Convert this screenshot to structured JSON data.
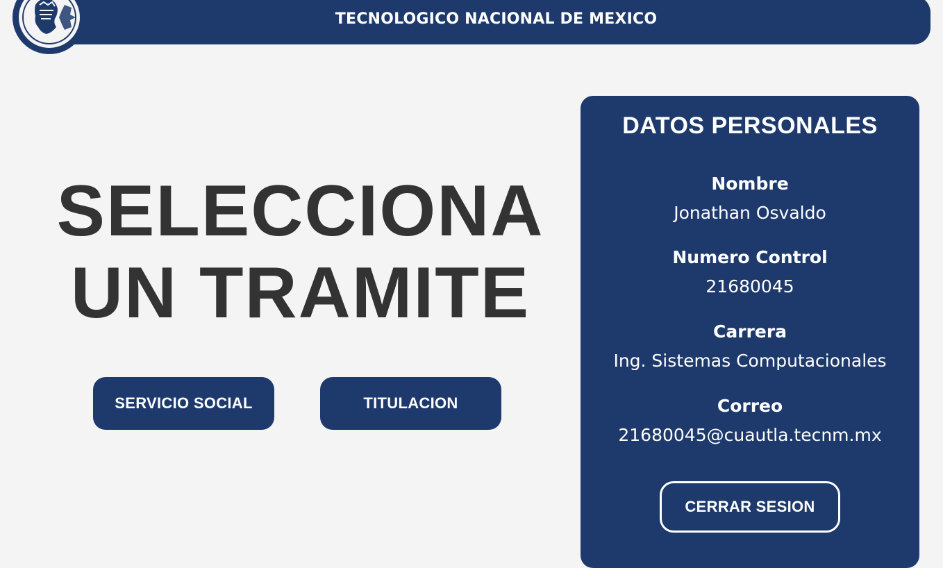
{
  "header": {
    "title": "TECNOLOGICO NACIONAL DE MEXICO",
    "logo_icon": "institution-logo-icon"
  },
  "main": {
    "headline_line1": "SELECCIONA",
    "headline_line2": "UN TRAMITE",
    "buttons": {
      "servicio_social": "SERVICIO SOCIAL",
      "titulacion": "TITULACION"
    }
  },
  "panel": {
    "title": "DATOS PERSONALES",
    "fields": [
      {
        "label": "Nombre",
        "value": "Jonathan Osvaldo"
      },
      {
        "label": "Numero Control",
        "value": "21680045"
      },
      {
        "label": "Carrera",
        "value": "Ing. Sistemas Computacionales"
      },
      {
        "label": "Correo",
        "value": "21680045@cuautla.tecnm.mx"
      }
    ],
    "logout_label": "CERRAR SESION"
  },
  "colors": {
    "primary": "#1e3a6c",
    "background": "#f4f4f4",
    "headline_text": "#333333",
    "light_text": "#ffffff"
  }
}
